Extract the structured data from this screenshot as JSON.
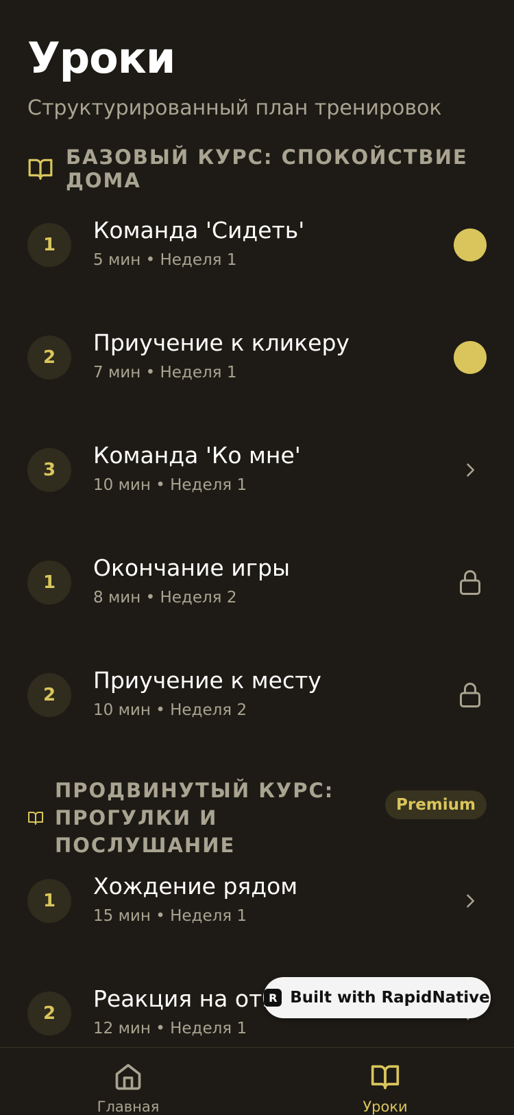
{
  "header": {
    "title": "Уроки",
    "subtitle": "Структурированный план тренировок"
  },
  "sections": [
    {
      "title": "Базовый курс: спокойствие дома",
      "icon": "book-open-icon",
      "lessons": [
        {
          "number": "1",
          "title": "Команда 'Сидеть'",
          "meta": "5 мин • Неделя 1",
          "status": "completed"
        },
        {
          "number": "2",
          "title": "Приучение к кликеру",
          "meta": "7 мин • Неделя 1",
          "status": "completed"
        },
        {
          "number": "3",
          "title": "Команда 'Ко мне'",
          "meta": "10 мин • Неделя 1",
          "status": "available"
        },
        {
          "number": "1",
          "title": "Окончание игры",
          "meta": "8 мин • Неделя 2",
          "status": "locked"
        },
        {
          "number": "2",
          "title": "Приучение к месту",
          "meta": "10 мин • Неделя 2",
          "status": "locked"
        }
      ]
    },
    {
      "title": "Продвинутый курс: прогулки и послушание",
      "icon": "book-open-icon",
      "badge": "Premium",
      "lessons": [
        {
          "number": "1",
          "title": "Хождение рядом",
          "meta": "15 мин • Неделя 1",
          "status": "available"
        },
        {
          "number": "2",
          "title": "Реакция на отвл",
          "meta": "12 мин • Неделя 1",
          "status": "available"
        }
      ]
    }
  ],
  "builder_badge": {
    "label": "Built with RapidNative"
  },
  "tabbar": {
    "items": [
      {
        "label": "Главная",
        "icon": "home-icon",
        "active": false
      },
      {
        "label": "Уроки",
        "icon": "book-open-icon",
        "active": true
      }
    ]
  },
  "colors": {
    "background": "#1e1b16",
    "accent": "#d9c55c",
    "muted_text": "#a9a491",
    "circle_bg": "#302c1e"
  }
}
